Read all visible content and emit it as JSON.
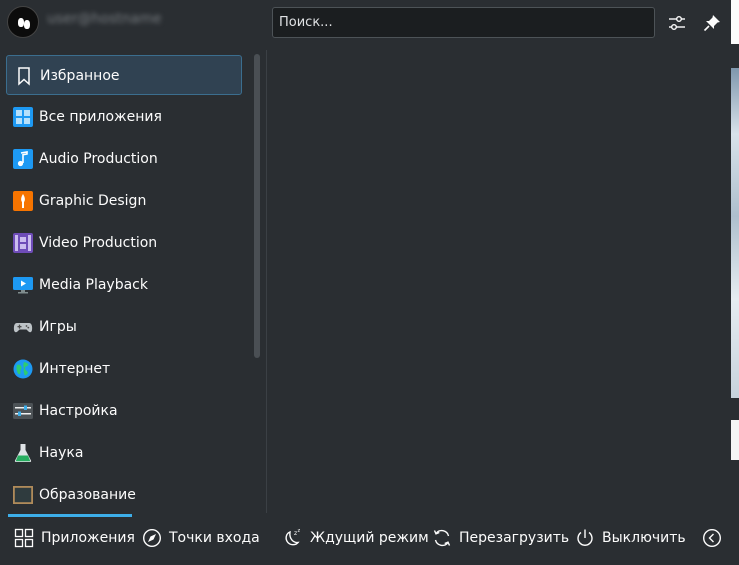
{
  "header": {
    "username": "user@hostname",
    "search_placeholder": "Поиск..."
  },
  "categories": [
    {
      "label": "Избранное",
      "icon": "bookmark-icon"
    },
    {
      "label": "Все приложения",
      "icon": "all-apps-grid-icon"
    },
    {
      "label": "Audio Production",
      "icon": "music-note-icon"
    },
    {
      "label": "Graphic Design",
      "icon": "graphic-design-icon"
    },
    {
      "label": "Video Production",
      "icon": "film-strip-icon"
    },
    {
      "label": "Media Playback",
      "icon": "monitor-play-icon"
    },
    {
      "label": "Игры",
      "icon": "gamepad-icon"
    },
    {
      "label": "Интернет",
      "icon": "globe-icon"
    },
    {
      "label": "Настройка",
      "icon": "settings-sliders-icon"
    },
    {
      "label": "Наука",
      "icon": "flask-icon"
    },
    {
      "label": "Образование",
      "icon": "blackboard-icon"
    }
  ],
  "selected_category": "Избранное",
  "footer": {
    "tabs": [
      {
        "label": "Приложения",
        "icon": "apps-grid-icon",
        "active": true
      },
      {
        "label": "Точки входа",
        "icon": "compass-icon",
        "active": false
      }
    ],
    "power": [
      {
        "label": "Ждущий режим",
        "icon": "sleep-moon-icon"
      },
      {
        "label": "Перезагрузить",
        "icon": "restart-icon"
      },
      {
        "label": "Выключить",
        "icon": "power-icon"
      }
    ],
    "more_icon": "chevron-left-circle-icon"
  },
  "colors": {
    "panel_bg": "#2a2e32",
    "selection_bg": "#304252",
    "selection_border": "#3b6e8f",
    "accent": "#3daee9",
    "text": "#fcfcfc"
  }
}
